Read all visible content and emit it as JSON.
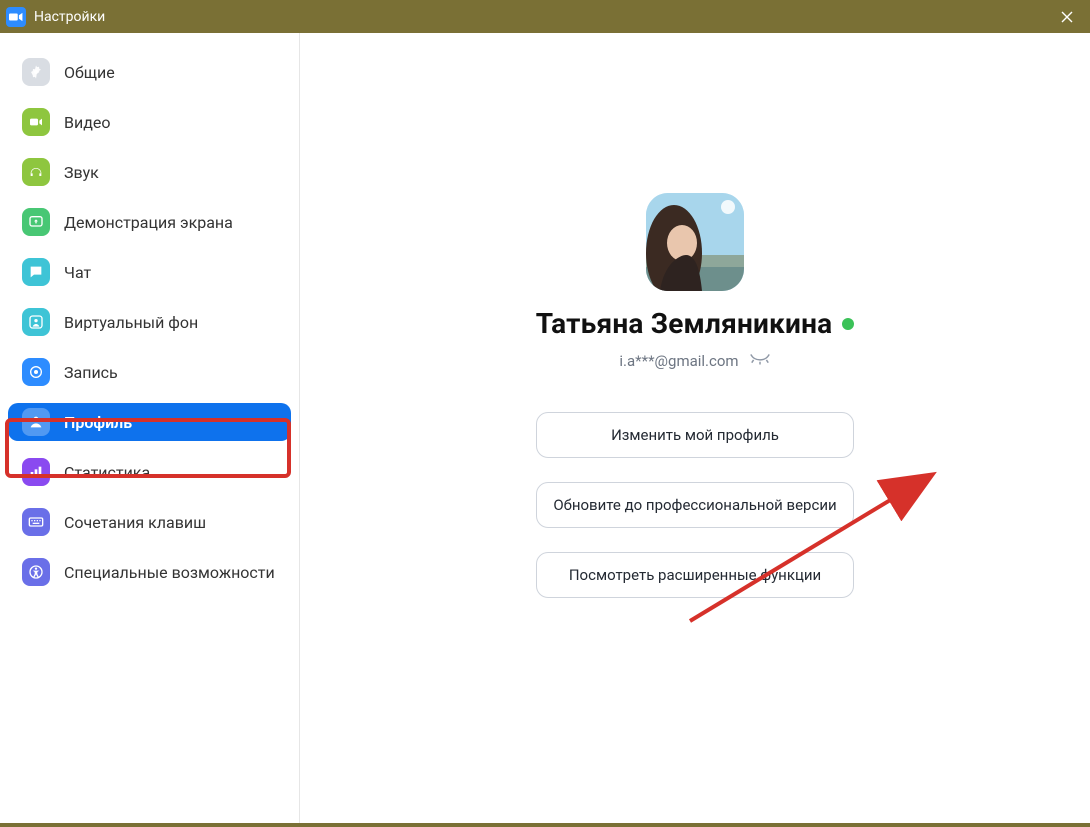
{
  "window": {
    "title": "Настройки"
  },
  "sidebar": {
    "items": [
      {
        "label": "Общие",
        "iconColor": "#d9dde3",
        "glyph": "gear"
      },
      {
        "label": "Видео",
        "iconColor": "#8ec63f",
        "glyph": "video"
      },
      {
        "label": "Звук",
        "iconColor": "#8ec63f",
        "glyph": "headphones"
      },
      {
        "label": "Демонстрация экрана",
        "iconColor": "#48c774",
        "glyph": "share"
      },
      {
        "label": "Чат",
        "iconColor": "#3ec4d6",
        "glyph": "chat"
      },
      {
        "label": "Виртуальный фон",
        "iconColor": "#3ec4d6",
        "glyph": "bg"
      },
      {
        "label": "Запись",
        "iconColor": "#2d8cff",
        "glyph": "record"
      },
      {
        "label": "Профиль",
        "iconColor": "#ffffff",
        "glyph": "person",
        "active": true
      },
      {
        "label": "Статистика",
        "iconColor": "#8a4af0",
        "glyph": "stats"
      },
      {
        "label": "Сочетания клавиш",
        "iconColor": "#6a6fe8",
        "glyph": "keyboard"
      },
      {
        "label": "Специальные возможности",
        "iconColor": "#6a6fe8",
        "glyph": "accessibility"
      }
    ]
  },
  "profile": {
    "name": "Татьяна Земляникина",
    "email": "i.a***@gmail.com",
    "buttons": {
      "edit": "Изменить мой профиль",
      "upgrade": "Обновите до профессиональной версии",
      "advanced": "Посмотреть расширенные функции"
    }
  }
}
